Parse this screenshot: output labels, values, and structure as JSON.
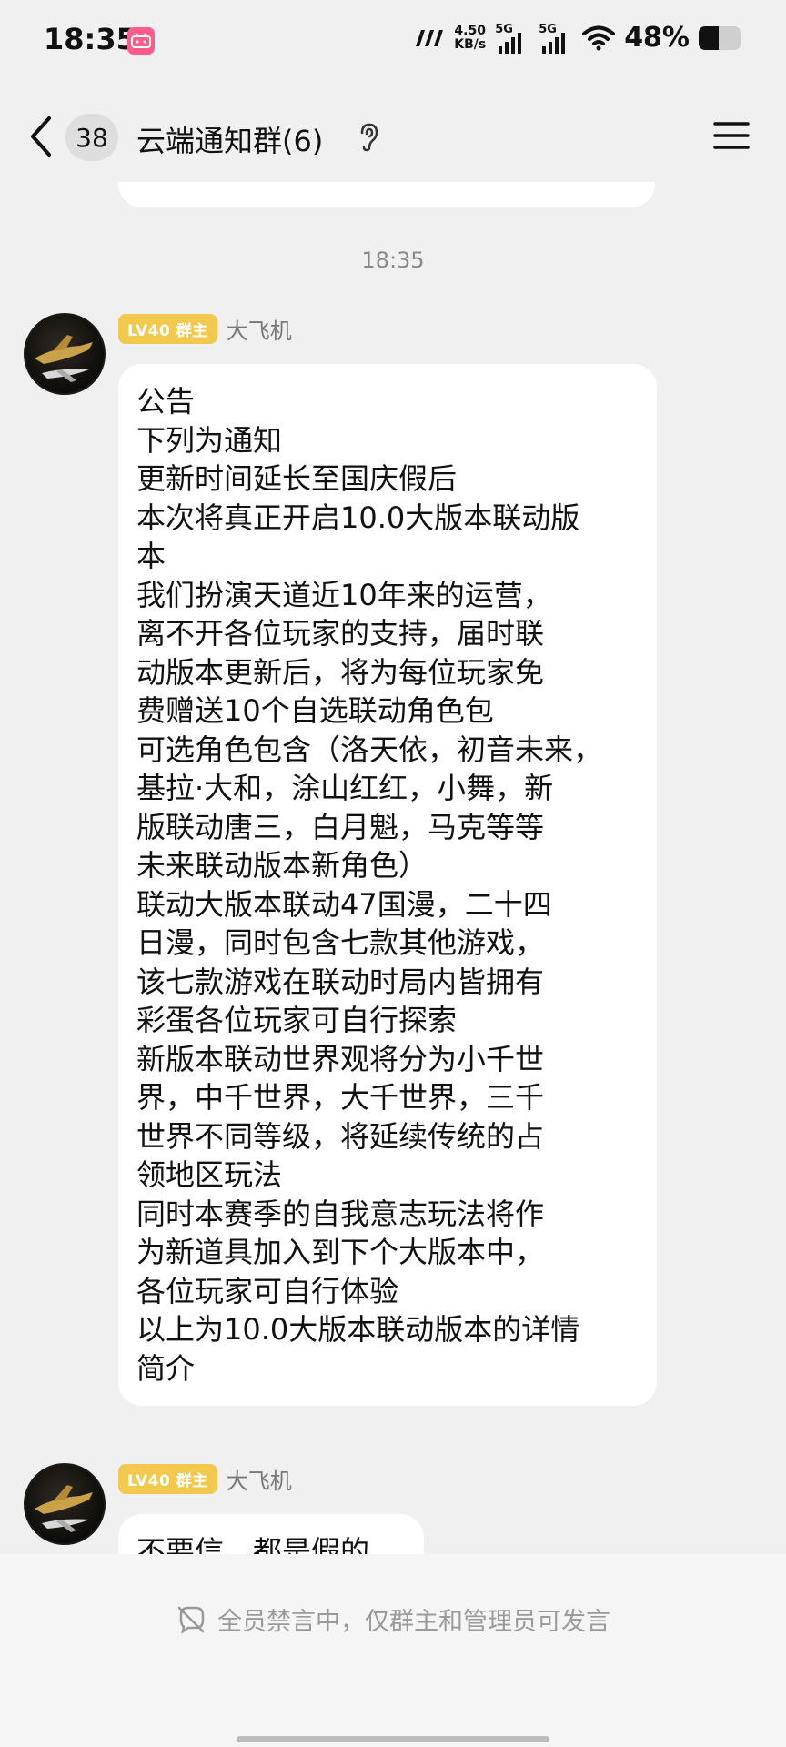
{
  "status_bar": {
    "time": "18:35",
    "app_badge": "bilibili",
    "net_speed": "4.50",
    "net_speed_unit": "KB/s",
    "sim1": "5G",
    "sim2": "5G",
    "battery": "48%",
    "battery_level": 0.48,
    "icons": [
      "bilibili-app-icon",
      "nfc-icon",
      "signal-icon",
      "wifi-icon",
      "battery-icon"
    ]
  },
  "header": {
    "back_icon": "chevron-left-icon",
    "unread_count": "38",
    "title": "云端通知群(6)",
    "ear_icon": "ear-icon",
    "menu_icon": "menu-icon"
  },
  "chat": {
    "timestamp": "18:35",
    "messages": [
      {
        "badge": "LV40 群主",
        "sender": "大飞机",
        "lines": [
          "公告",
          "下列为通知",
          "更新时间延长至国庆假后",
          "本次将真正开启10.0大版本联动版",
          "本",
          "我们扮演天道近10年来的运营，",
          "离不开各位玩家的支持，届时联",
          "动版本更新后，将为每位玩家免",
          "费赠送10个自选联动角色包",
          "可选角色包含（洛天依，初音未来，",
          "基拉·大和，涂山红红，小舞，新",
          "版联动唐三，白月魁，马克等等",
          "未来联动版本新角色）",
          "联动大版本联动47国漫，二十四",
          "日漫，同时包含七款其他游戏，",
          "该七款游戏在联动时局内皆拥有",
          "彩蛋各位玩家可自行探索",
          "新版本联动世界观将分为小千世",
          "界，中千世界，大千世界，三千",
          "世界不同等级，将延续传统的占",
          "领地区玩法",
          "同时本赛季的自我意志玩法将作",
          "为新道具加入到下个大版本中，",
          "各位玩家可自行体验",
          "以上为10.0大版本联动版本的详情",
          "简介"
        ]
      },
      {
        "badge": "LV40 群主",
        "sender": "大飞机",
        "lines": [
          "不要信，都是假的"
        ]
      }
    ]
  },
  "bottom": {
    "mute_icon": "mute-icon",
    "mute_notice": "全员禁言中，仅群主和管理员可发言"
  }
}
